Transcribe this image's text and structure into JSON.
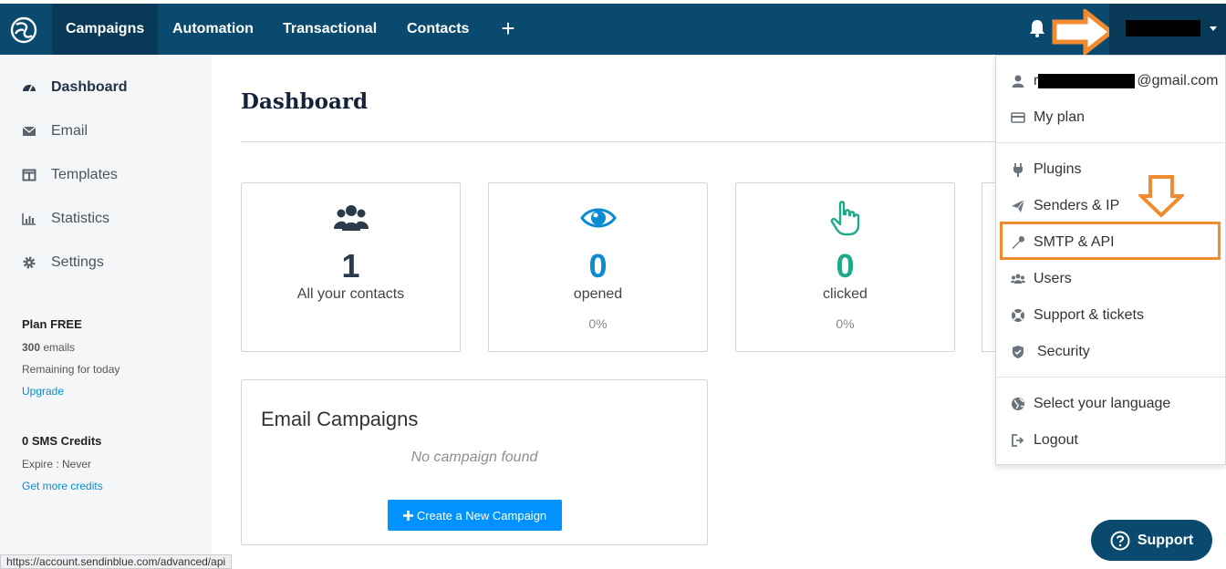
{
  "nav": {
    "items": [
      {
        "label": "Campaigns"
      },
      {
        "label": "Automation"
      },
      {
        "label": "Transactional"
      },
      {
        "label": "Contacts"
      }
    ],
    "plus_label": "+"
  },
  "sidebar": {
    "items": [
      {
        "label": "Dashboard",
        "icon": "dashboard-icon"
      },
      {
        "label": "Email",
        "icon": "envelope-icon"
      },
      {
        "label": "Templates",
        "icon": "templates-icon"
      },
      {
        "label": "Statistics",
        "icon": "bar-chart-icon"
      },
      {
        "label": "Settings",
        "icon": "gear-icon"
      }
    ],
    "plan": {
      "title": "Plan FREE",
      "emails_count": "300",
      "emails_label": "emails",
      "remaining": "Remaining for today",
      "upgrade": "Upgrade"
    },
    "sms": {
      "title": "0 SMS Credits",
      "expire": "Expire : Never",
      "more": "Get more credits"
    }
  },
  "main": {
    "title": "Dashboard",
    "stats": [
      {
        "value": "1",
        "label": "All your contacts",
        "percent": "",
        "icon": "users-icon",
        "color": "#2a3a4a"
      },
      {
        "value": "0",
        "label": "opened",
        "percent": "0%",
        "icon": "eye-icon",
        "color": "#0b8bd1"
      },
      {
        "value": "0",
        "label": "clicked",
        "percent": "0%",
        "icon": "pointer-hand-icon",
        "color": "#1fa88a"
      }
    ],
    "campaigns": {
      "title": "Email Campaigns",
      "empty": "No campaign found",
      "create_button": "Create a New Campaign",
      "create_button_icon": "plus-icon"
    }
  },
  "dropdown": {
    "email_suffix": "@gmail.com",
    "email_prefix": "r",
    "items_group1": [
      {
        "label": "My plan",
        "icon": "credit-card-icon"
      }
    ],
    "items_group2": [
      {
        "label": "Plugins",
        "icon": "plug-icon"
      },
      {
        "label": "Senders & IP",
        "icon": "paper-plane-icon"
      },
      {
        "label": "SMTP & API",
        "icon": "wrench-icon"
      },
      {
        "label": "Users",
        "icon": "users-icon"
      },
      {
        "label": "Support & tickets",
        "icon": "lifebuoy-icon"
      },
      {
        "label": "Security",
        "icon": "shield-icon"
      }
    ],
    "items_group3": [
      {
        "label": "Select your language",
        "icon": "globe-icon"
      },
      {
        "label": "Logout",
        "icon": "logout-icon"
      }
    ]
  },
  "support": {
    "label": "Support"
  },
  "status_bar": {
    "url": "https://account.sendinblue.com/advanced/api"
  },
  "colors": {
    "topbar": "#0b4a6f",
    "primary_button": "#0092ff",
    "annotation_orange": "#f28b30"
  }
}
